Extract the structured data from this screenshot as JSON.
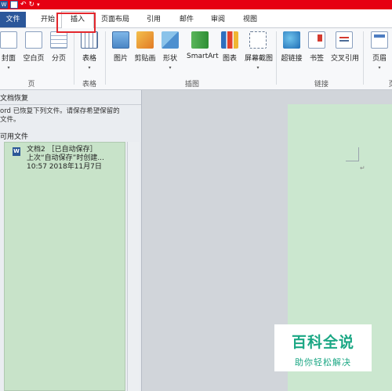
{
  "quick_access": {
    "word_icon": "W",
    "icons": [
      "word-icon",
      "save-icon",
      "undo-icon",
      "redo-icon",
      "customize-dropdown-icon"
    ],
    "undo_glyph": "↶",
    "redo_glyph": "↻",
    "dropdown_glyph": "▾"
  },
  "tabs": {
    "file": "文件",
    "home": "开始",
    "insert": "插入",
    "layout": "页面布局",
    "references": "引用",
    "mailings": "邮件",
    "review": "审阅",
    "view": "视图",
    "active": "插入"
  },
  "ribbon": {
    "cover": "封面",
    "blank": "空白页",
    "page_break": "分页",
    "table": "表格",
    "picture": "图片",
    "clipart": "剪贴画",
    "shapes": "形状",
    "smartart": "SmartArt",
    "chart": "图表",
    "screenshot": "屏幕截图",
    "hyperlink": "超链接",
    "bookmark": "书签",
    "crossref": "交叉引用",
    "header": "页眉",
    "dropdown_arrow": "▾",
    "groups": {
      "pages": "页",
      "tables": "表格",
      "illustrations": "插图",
      "links": "链接",
      "header_footer": "页"
    }
  },
  "recovery_pane": {
    "title": "文档恢复",
    "description_line1": "ord 已恢复下列文件。请保存希望保留的",
    "description_line2": "文件。",
    "available_label": "可用文件",
    "item": {
      "icon": "W",
      "name": "文档2 ［已自动保存］",
      "info": "上次“自动保存”时创建...",
      "time": "10:57 2018年11月7日"
    }
  },
  "document": {
    "paragraph_mark": "↵"
  },
  "watermark": {
    "main": "百科全说",
    "sub": "助你轻松解决"
  },
  "colors": {
    "title_bar": "#e60012",
    "file_tab": "#2b579a",
    "highlight": "#e3272d",
    "page": "#cbe7cf",
    "watermark": "#1ba784"
  }
}
